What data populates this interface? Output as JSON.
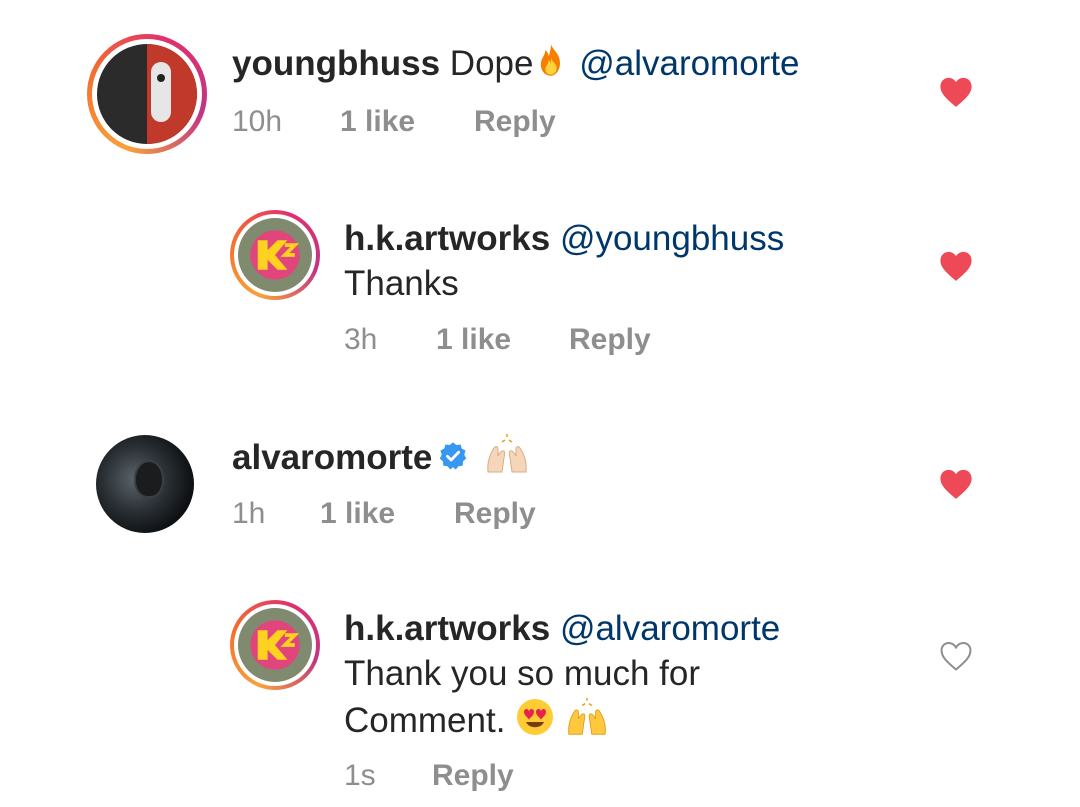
{
  "comments": [
    {
      "username": "youngbhuss",
      "text": "Dope",
      "emoji_after_text": "fire-emoji",
      "mention": "@alvaromorte",
      "time": "10h",
      "likes": "1 like",
      "reply": "Reply",
      "liked": true
    },
    {
      "username": "h.k.artworks",
      "mention": "@youngbhuss",
      "text": "Thanks",
      "time": "3h",
      "likes": "1 like",
      "reply": "Reply",
      "liked": true
    },
    {
      "username": "alvaromorte",
      "verified": true,
      "emoji": "raising-hands-emoji",
      "time": "1h",
      "likes": "1 like",
      "reply": "Reply",
      "liked": true
    },
    {
      "username": "h.k.artworks",
      "mention": "@alvaromorte",
      "text_line1": "Thank you so much for",
      "text_line2": "Comment.",
      "emoji_after_text": [
        "heart-eyes-emoji",
        "raising-hands-emoji"
      ],
      "time": "1s",
      "reply": "Reply",
      "liked": false
    }
  ],
  "colors": {
    "heart_liked": "#ed4956",
    "mention": "#00376b",
    "meta": "#8e8e8e",
    "verified": "#3897f0"
  }
}
